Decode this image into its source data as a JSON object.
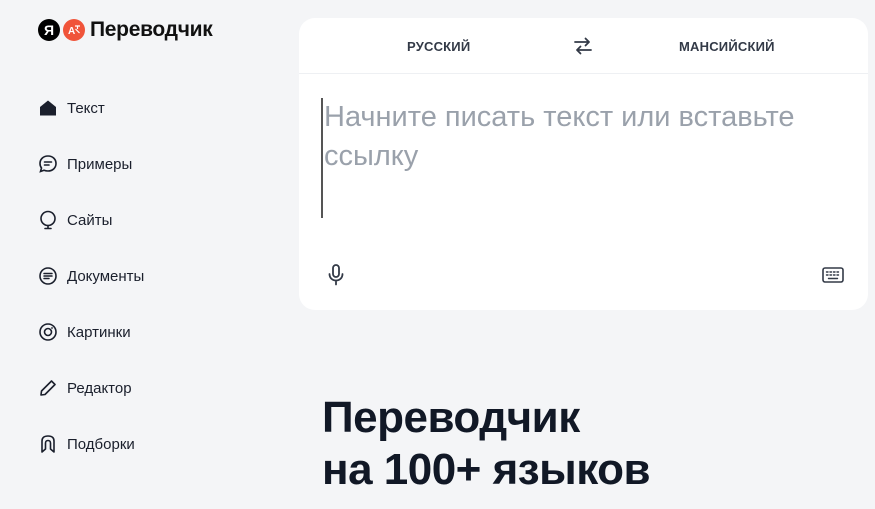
{
  "logo": {
    "ya_letter": "Я",
    "title": "Переводчик"
  },
  "sidebar": {
    "items": [
      {
        "label": "Текст",
        "icon": "home-icon",
        "active": true
      },
      {
        "label": "Примеры",
        "icon": "chat-bubble-icon"
      },
      {
        "label": "Сайты",
        "icon": "globe-pin-icon"
      },
      {
        "label": "Документы",
        "icon": "document-icon"
      },
      {
        "label": "Картинки",
        "icon": "camera-icon"
      },
      {
        "label": "Редактор",
        "icon": "pencil-icon"
      },
      {
        "label": "Подборки",
        "icon": "bookmark-icon"
      }
    ]
  },
  "translator": {
    "source_lang": "РУССКИЙ",
    "target_lang": "МАНСИЙСКИЙ",
    "input_value": "",
    "input_placeholder": "Начните писать текст или вставьте ссылку"
  },
  "hero": {
    "line1": "Переводчик",
    "line2": "на 100+ языков"
  },
  "colors": {
    "background": "#f4f5f7",
    "card": "#ffffff",
    "text": "#1a1f2c",
    "placeholder": "#9aa1ab",
    "logo_accent": "#f0543a"
  }
}
